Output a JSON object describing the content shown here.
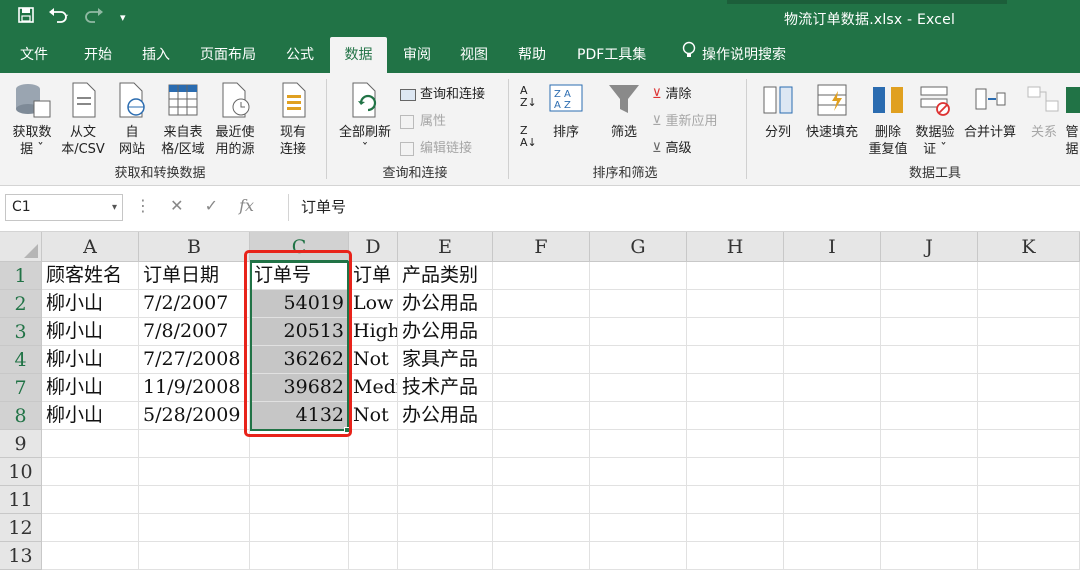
{
  "window": {
    "title": "物流订单数据.xlsx  -  Excel"
  },
  "qat": {
    "save_icon": "save-icon",
    "undo_icon": "undo-icon",
    "redo_icon": "redo-icon"
  },
  "tabs": [
    "文件",
    "开始",
    "插入",
    "页面布局",
    "公式",
    "数据",
    "审阅",
    "视图",
    "帮助",
    "PDF工具集",
    "操作说明搜索"
  ],
  "active_tab": "数据",
  "ribbon": {
    "get_data": "获取数\n据 ˇ",
    "from_text": "从文\n本/CSV",
    "from_web": "自\n网站",
    "from_table": "来自表\n格/区域",
    "recent_sources": "最近使\n用的源",
    "existing_conn": "现有\n连接",
    "group1": "获取和转换数据",
    "refresh_all": "全部刷新\nˇ",
    "queries_conn": "查询和连接",
    "properties": "属性",
    "edit_links": "编辑链接",
    "group2": "查询和连接",
    "sort": "排序",
    "filter": "筛选",
    "clear": "清除",
    "reapply": "重新应用",
    "advanced": "高级",
    "group3": "排序和筛选",
    "text_to_columns": "分列",
    "flash_fill": "快速填充",
    "remove_dup": "删除\n重复值",
    "data_validation": "数据验\n证 ˇ",
    "consolidate": "合并计算",
    "relationships": "关系",
    "manage": "管\n据",
    "group4": "数据工具"
  },
  "formula_bar": {
    "name_box": "C1",
    "fx": "fx",
    "content": "订单号"
  },
  "columns": [
    "A",
    "B",
    "C",
    "D",
    "E",
    "F",
    "G",
    "H",
    "I",
    "J",
    "K"
  ],
  "rows": [
    {
      "num": "1",
      "cells": [
        "顾客姓名",
        "订单日期",
        "订单号",
        "订单",
        "产品类别"
      ]
    },
    {
      "num": "2",
      "cells": [
        "柳小山",
        "7/2/2007",
        "54019",
        "Low",
        "办公用品"
      ]
    },
    {
      "num": "3",
      "cells": [
        "柳小山",
        "7/8/2007",
        "20513",
        "High",
        "办公用品"
      ]
    },
    {
      "num": "4",
      "cells": [
        "柳小山",
        "7/27/2008",
        "36262",
        "Not",
        "家具产品"
      ]
    },
    {
      "num": "7",
      "cells": [
        "柳小山",
        "11/9/2008",
        "39682",
        "Medi",
        "技术产品"
      ]
    },
    {
      "num": "8",
      "cells": [
        "柳小山",
        "5/28/2009",
        "4132",
        "Not",
        "办公用品"
      ]
    },
    {
      "num": "9",
      "cells": [
        "",
        "",
        "",
        "",
        ""
      ]
    },
    {
      "num": "10",
      "cells": [
        "",
        "",
        "",
        "",
        ""
      ]
    },
    {
      "num": "11",
      "cells": [
        "",
        "",
        "",
        "",
        ""
      ]
    },
    {
      "num": "12",
      "cells": [
        "",
        "",
        "",
        "",
        ""
      ]
    },
    {
      "num": "13",
      "cells": [
        "",
        "",
        "",
        "",
        ""
      ]
    }
  ],
  "colors": {
    "accent": "#217346",
    "highlight": "#e8231a",
    "selection_shade": "#c6c6c6"
  }
}
